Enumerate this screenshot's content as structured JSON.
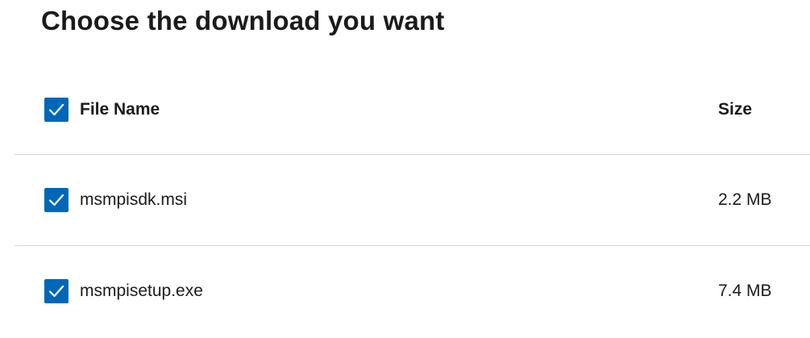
{
  "title": "Choose the download you want",
  "colors": {
    "checkbox": "#0067b8",
    "divider": "#d6d6d6"
  },
  "table": {
    "header": {
      "name_label": "File Name",
      "size_label": "Size",
      "select_all_checked": true
    },
    "rows": [
      {
        "name": "msmpisdk.msi",
        "size": "2.2 MB",
        "checked": true
      },
      {
        "name": "msmpisetup.exe",
        "size": "7.4 MB",
        "checked": true
      }
    ]
  }
}
